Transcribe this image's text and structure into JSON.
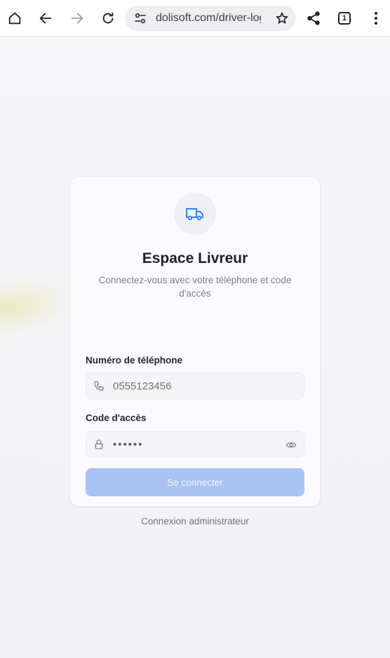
{
  "browser": {
    "url": "dolisoft.com/driver-log",
    "tab_count": "1"
  },
  "login": {
    "title": "Espace Livreur",
    "subtitle": "Connectez-vous avec votre téléphone et code d'accès",
    "phone_label": "Numéro de téléphone",
    "phone_placeholder": "0555123456",
    "code_label": "Code d'accès",
    "code_value": "••••••",
    "submit_label": "Se connecter",
    "admin_link": "Connexion administrateur"
  },
  "icons": {
    "logo": "truck-icon",
    "phone": "phone-icon",
    "lock": "lock-icon",
    "eye": "eye-icon"
  },
  "colors": {
    "accent": "#3b82f6",
    "button_disabled": "#a9c4f2"
  }
}
